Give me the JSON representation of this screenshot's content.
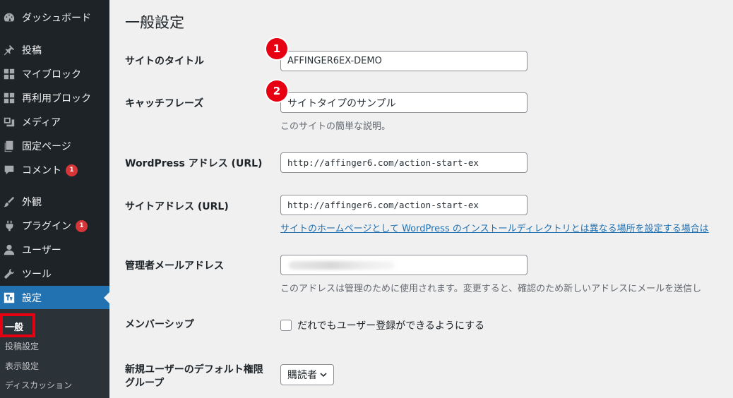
{
  "sidebar": {
    "items": [
      {
        "label": "ダッシュボード",
        "icon": "dashboard-icon"
      },
      {
        "label": "投稿",
        "icon": "pin-icon"
      },
      {
        "label": "マイブロック",
        "icon": "grid-icon"
      },
      {
        "label": "再利用ブロック",
        "icon": "grid-icon"
      },
      {
        "label": "メディア",
        "icon": "media-icon"
      },
      {
        "label": "固定ページ",
        "icon": "page-icon"
      },
      {
        "label": "コメント",
        "icon": "comment-icon",
        "badge": "1"
      },
      {
        "label": "外観",
        "icon": "brush-icon"
      },
      {
        "label": "プラグイン",
        "icon": "plugin-icon",
        "badge": "1"
      },
      {
        "label": "ユーザー",
        "icon": "user-icon"
      },
      {
        "label": "ツール",
        "icon": "wrench-icon"
      },
      {
        "label": "設定",
        "icon": "settings-icon",
        "active": true
      }
    ],
    "submenu": [
      "一般",
      "投稿設定",
      "表示設定",
      "ディスカッション"
    ],
    "active_color": "#2271b1",
    "badge_color": "#d63638"
  },
  "main": {
    "title": "一般設定",
    "fields": {
      "site_title": {
        "label": "サイトのタイトル",
        "value": "AFFINGER6EX-DEMO"
      },
      "tagline": {
        "label": "キャッチフレーズ",
        "value": "サイトタイプのサンプル",
        "description": "このサイトの簡単な説明。"
      },
      "wp_address": {
        "label": "WordPress アドレス (URL)",
        "value": "http://affinger6.com/action-start-ex"
      },
      "site_address": {
        "label": "サイトアドレス (URL)",
        "value": "http://affinger6.com/action-start-ex",
        "description": "サイトのホームページとして WordPress のインストールディレクトリとは異なる場所を設定する場合は"
      },
      "admin_email": {
        "label": "管理者メールアドレス",
        "description": "このアドレスは管理のために使用されます。変更すると、確認のため新しいアドレスにメールを送信し"
      },
      "membership": {
        "label": "メンバーシップ",
        "checkbox_label": "だれでもユーザー登録ができるようにする",
        "checked": false
      },
      "default_role": {
        "label_line1": "新規ユーザーのデフォルト権限",
        "label_line2": "グループ",
        "value": "購読者"
      }
    }
  },
  "annotations": {
    "marker1": "1",
    "marker2": "2",
    "color": "#e60012"
  }
}
